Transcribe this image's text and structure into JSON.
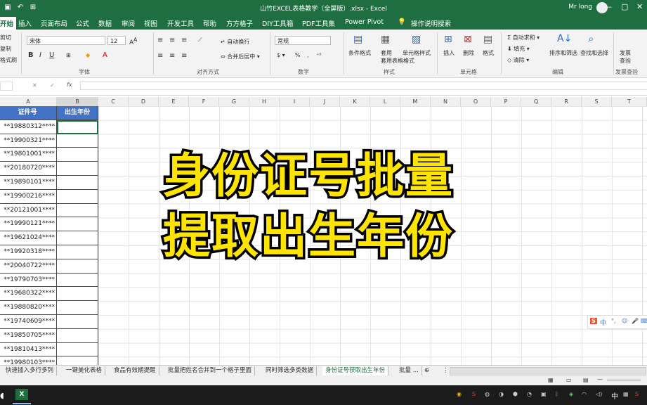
{
  "window": {
    "title": "山竹EXCEL表格教学（全屏版）.xlsx - Excel",
    "user": "Mr long",
    "controls": [
      "—",
      "▢",
      "✕"
    ]
  },
  "menu": {
    "items": [
      "开始",
      "插入",
      "页面布局",
      "公式",
      "数据",
      "审阅",
      "视图",
      "开发工具",
      "帮助",
      "方方格子",
      "DIY工具箱",
      "PDF工具集",
      "Power Pivot"
    ],
    "search": "操作说明搜索"
  },
  "ribbon": {
    "clipboard": [
      "剪切",
      "复制",
      "格式刷"
    ],
    "font_name": "宋体",
    "font_size": "12",
    "font_group": "字体",
    "wrap_text": "自动换行",
    "merge_center": "合并后居中",
    "alignment_group": "对齐方式",
    "number_format": "常规",
    "number_group": "数字",
    "conditional_format": "条件格式",
    "table_format": "套用表格格式",
    "cell_style": "单元格样式",
    "styles_group": "样式",
    "insert": "插入",
    "delete": "删除",
    "format": "格式",
    "cells_group": "单元格",
    "autosum": "自动求和",
    "fill": "填充",
    "clear": "清除",
    "sort_filter": "排序和筛选",
    "find_select": "查找和选择",
    "editing_group": "编辑",
    "invoice_check": "发票查验",
    "invoice_group": "发票查验"
  },
  "formula_bar": {
    "name_box": "",
    "cancel": "✕",
    "enter": "✓",
    "fx": "fx",
    "value": ""
  },
  "columns": [
    "A",
    "B",
    "C",
    "D",
    "E",
    "F",
    "G",
    "H",
    "I",
    "J",
    "K",
    "L",
    "M",
    "N",
    "O",
    "P",
    "Q",
    "R",
    "S",
    "T"
  ],
  "table": {
    "headers": [
      "证件号",
      "出生年份"
    ],
    "ids": [
      "**19880312****",
      "**19900321****",
      "**19801001****",
      "**20180720****",
      "**19890101****",
      "**19900216****",
      "**20121001****",
      "**19990121****",
      "**19621024****",
      "**19920318****",
      "**20040722****",
      "**19790703****",
      "**19680322****",
      "**19880820****",
      "**19740609****",
      "**19850705****",
      "**19810413****",
      "**19980103****"
    ]
  },
  "overlay": {
    "line1": "身份证号批量",
    "line2": "提取出生年份"
  },
  "sheet_tabs": [
    "快速插入多行多列",
    "一键美化表格",
    "食品有效期提醒",
    "批量把姓名合并到一个格子里面",
    "同时筛选多类数据",
    "身份证号获取出生年份",
    "批量 ..."
  ],
  "ime": {
    "label": "中"
  },
  "taskbar": {
    "ime": "中"
  },
  "colors": {
    "excel_green": "#1e6e42",
    "header_blue": "#4472c4",
    "overlay_yellow": "#ffe400"
  }
}
